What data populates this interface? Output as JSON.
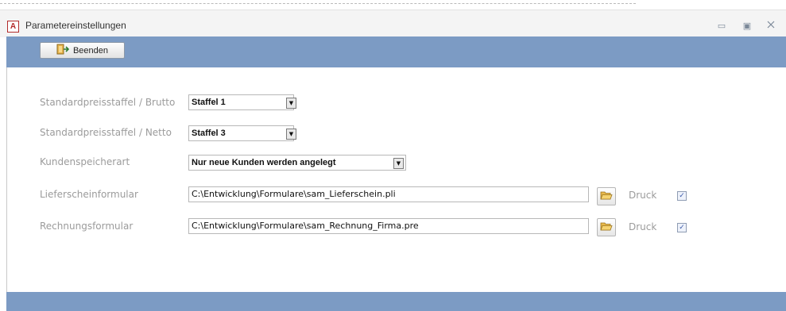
{
  "window": {
    "title": "Parametereinstellungen",
    "app_icon_letter": "A",
    "minimize_symbol": "▭",
    "restore_symbol": "▣",
    "close_symbol": "ꟸ"
  },
  "toolbar": {
    "beenden_label": "Beenden"
  },
  "form": {
    "brutto": {
      "label": "Standardpreisstaffel / Brutto",
      "value": "Staffel 1"
    },
    "netto": {
      "label": "Standardpreisstaffel / Netto",
      "value": "Staffel 3"
    },
    "kunden": {
      "label": "Kundenspeicherart",
      "value": "Nur neue Kunden werden angelegt"
    },
    "liefer": {
      "label": "Lieferscheinformular",
      "value": "C:\\Entwicklung\\Formulare\\sam_Lieferschein.pli",
      "druck_label": "Druck",
      "druck_checked": true
    },
    "rechnung": {
      "label": "Rechnungsformular",
      "value": "C:\\Entwicklung\\Formulare\\sam_Rechnung_Firma.pre",
      "druck_label": "Druck",
      "druck_checked": true
    }
  },
  "symbols": {
    "dropdown": "▼",
    "check": "✓"
  },
  "colors": {
    "accent_bar": "#7c9bc4",
    "label_gray": "#9b9b9b",
    "icon_red": "#b22a2a"
  }
}
